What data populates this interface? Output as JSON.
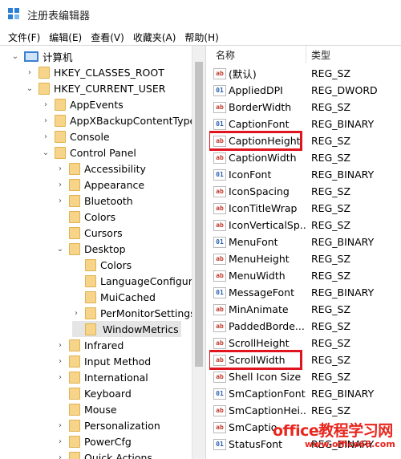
{
  "window": {
    "title": "注册表编辑器"
  },
  "menu": [
    "文件(F)",
    "编辑(E)",
    "查看(V)",
    "收藏夹(A)",
    "帮助(H)"
  ],
  "tree": [
    {
      "label": "计算机",
      "depth": 0,
      "expander": "v",
      "icon": "computer"
    },
    {
      "label": "HKEY_CLASSES_ROOT",
      "depth": 1,
      "expander": ">",
      "icon": "folder"
    },
    {
      "label": "HKEY_CURRENT_USER",
      "depth": 1,
      "expander": "v",
      "icon": "folder"
    },
    {
      "label": "AppEvents",
      "depth": 2,
      "expander": ">",
      "icon": "folder"
    },
    {
      "label": "AppXBackupContentType",
      "depth": 2,
      "expander": ">",
      "icon": "folder"
    },
    {
      "label": "Console",
      "depth": 2,
      "expander": ">",
      "icon": "folder"
    },
    {
      "label": "Control Panel",
      "depth": 2,
      "expander": "v",
      "icon": "folder"
    },
    {
      "label": "Accessibility",
      "depth": 3,
      "expander": ">",
      "icon": "folder"
    },
    {
      "label": "Appearance",
      "depth": 3,
      "expander": ">",
      "icon": "folder"
    },
    {
      "label": "Bluetooth",
      "depth": 3,
      "expander": ">",
      "icon": "folder"
    },
    {
      "label": "Colors",
      "depth": 3,
      "expander": "",
      "icon": "folder"
    },
    {
      "label": "Cursors",
      "depth": 3,
      "expander": "",
      "icon": "folder"
    },
    {
      "label": "Desktop",
      "depth": 3,
      "expander": "v",
      "icon": "folder"
    },
    {
      "label": "Colors",
      "depth": 4,
      "expander": "",
      "icon": "folder"
    },
    {
      "label": "LanguageConfigura",
      "depth": 4,
      "expander": "",
      "icon": "folder"
    },
    {
      "label": "MuiCached",
      "depth": 4,
      "expander": "",
      "icon": "folder"
    },
    {
      "label": "PerMonitorSettings",
      "depth": 4,
      "expander": ">",
      "icon": "folder"
    },
    {
      "label": "WindowMetrics",
      "depth": 4,
      "expander": "",
      "icon": "folder",
      "selected": true
    },
    {
      "label": "Infrared",
      "depth": 3,
      "expander": ">",
      "icon": "folder"
    },
    {
      "label": "Input Method",
      "depth": 3,
      "expander": ">",
      "icon": "folder"
    },
    {
      "label": "International",
      "depth": 3,
      "expander": ">",
      "icon": "folder"
    },
    {
      "label": "Keyboard",
      "depth": 3,
      "expander": "",
      "icon": "folder"
    },
    {
      "label": "Mouse",
      "depth": 3,
      "expander": "",
      "icon": "folder"
    },
    {
      "label": "Personalization",
      "depth": 3,
      "expander": ">",
      "icon": "folder"
    },
    {
      "label": "PowerCfg",
      "depth": 3,
      "expander": ">",
      "icon": "folder"
    },
    {
      "label": "Quick Actions",
      "depth": 3,
      "expander": ">",
      "icon": "folder"
    }
  ],
  "list": {
    "headers": {
      "name": "名称",
      "type": "类型"
    },
    "rows": [
      {
        "name": "(默认)",
        "type": "REG_SZ",
        "kind": "sz"
      },
      {
        "name": "AppliedDPI",
        "type": "REG_DWORD",
        "kind": "bin"
      },
      {
        "name": "BorderWidth",
        "type": "REG_SZ",
        "kind": "sz"
      },
      {
        "name": "CaptionFont",
        "type": "REG_BINARY",
        "kind": "bin"
      },
      {
        "name": "CaptionHeight",
        "type": "REG_SZ",
        "kind": "sz",
        "highlight": true
      },
      {
        "name": "CaptionWidth",
        "type": "REG_SZ",
        "kind": "sz"
      },
      {
        "name": "IconFont",
        "type": "REG_BINARY",
        "kind": "bin"
      },
      {
        "name": "IconSpacing",
        "type": "REG_SZ",
        "kind": "sz"
      },
      {
        "name": "IconTitleWrap",
        "type": "REG_SZ",
        "kind": "sz"
      },
      {
        "name": "IconVerticalSp...",
        "type": "REG_SZ",
        "kind": "sz"
      },
      {
        "name": "MenuFont",
        "type": "REG_BINARY",
        "kind": "bin"
      },
      {
        "name": "MenuHeight",
        "type": "REG_SZ",
        "kind": "sz"
      },
      {
        "name": "MenuWidth",
        "type": "REG_SZ",
        "kind": "sz"
      },
      {
        "name": "MessageFont",
        "type": "REG_BINARY",
        "kind": "bin"
      },
      {
        "name": "MinAnimate",
        "type": "REG_SZ",
        "kind": "sz"
      },
      {
        "name": "PaddedBorde...",
        "type": "REG_SZ",
        "kind": "sz"
      },
      {
        "name": "ScrollHeight",
        "type": "REG_SZ",
        "kind": "sz"
      },
      {
        "name": "ScrollWidth",
        "type": "REG_SZ",
        "kind": "sz",
        "highlight": true
      },
      {
        "name": "Shell Icon Size",
        "type": "REG_SZ",
        "kind": "sz"
      },
      {
        "name": "SmCaptionFont",
        "type": "REG_BINARY",
        "kind": "bin"
      },
      {
        "name": "SmCaptionHei...",
        "type": "REG_SZ",
        "kind": "sz"
      },
      {
        "name": "SmCaptio",
        "type": "",
        "kind": "sz"
      },
      {
        "name": "StatusFont",
        "type": "REG_BINARY",
        "kind": "bin"
      }
    ]
  },
  "watermark": {
    "main": "office教程学习网",
    "sub": "www.office68.com"
  },
  "colors": {
    "highlight": "#e0141e",
    "folder": "#f6d48a",
    "selection": "#e5e5e5"
  }
}
